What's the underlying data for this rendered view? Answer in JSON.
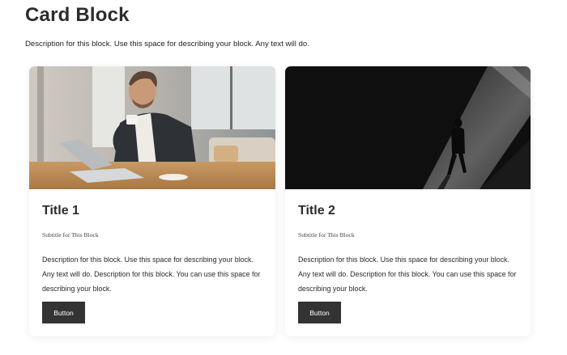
{
  "page": {
    "title": "Card Block",
    "description": "Description for this block. Use this space for describing your block. Any text will do."
  },
  "cards": [
    {
      "image_alt": "businessman-with-coffee-and-laptop",
      "title": "Title 1",
      "subtitle": "Subtitle for This Block",
      "description": "Description for this block. Use this space for describing your block. Any text will do. Description for this block. You can use this space for describing your block.",
      "button_label": "Button"
    },
    {
      "image_alt": "silhouette-person-walking-in-light",
      "title": "Title 2",
      "subtitle": "Subtitle for This Block",
      "description": "Description for this block. Use this space for describing your block. Any text will do. Description for this block. You can use this space for describing your block.",
      "button_label": "Button"
    }
  ],
  "colors": {
    "button_bg": "#333333",
    "button_text": "#ffffff",
    "text": "#2c2c2c"
  }
}
